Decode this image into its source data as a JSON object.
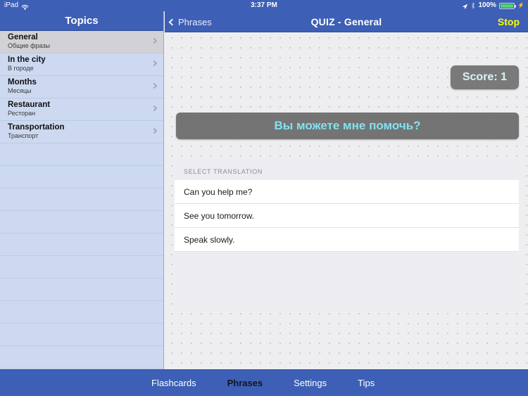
{
  "statusbar": {
    "device": "iPad",
    "wifi_icon": "wifi-icon",
    "time": "3:37 PM",
    "location_icon": "location-arrow-icon",
    "bluetooth_icon": "bluetooth-icon",
    "battery_percent": "100%",
    "battery_icon": "battery-full-icon"
  },
  "sidebar": {
    "title": "Topics",
    "items": [
      {
        "title": "General",
        "subtitle": "Общие фразы",
        "selected": true,
        "chevron": "chevron-right-icon"
      },
      {
        "title": "In the city",
        "subtitle": "В городе",
        "selected": false,
        "chevron": "chevron-right-icon"
      },
      {
        "title": "Months",
        "subtitle": "Месяцы",
        "selected": false,
        "chevron": "chevron-right-icon"
      },
      {
        "title": "Restaurant",
        "subtitle": "Ресторан",
        "selected": false,
        "chevron": "chevron-right-icon"
      },
      {
        "title": "Transportation",
        "subtitle": "Транспорт",
        "selected": false,
        "chevron": "chevron-right-icon"
      }
    ]
  },
  "nav": {
    "back_label": "Phrases",
    "back_icon": "chevron-left-icon",
    "title": "QUIZ - General",
    "stop_label": "Stop"
  },
  "quiz": {
    "score_label": "Score: 1",
    "question": "Вы можете мне помочь?",
    "section_header": "SELECT TRANSLATION",
    "options": [
      "Can you help me?",
      "See you tomorrow.",
      "Speak slowly."
    ]
  },
  "tabbar": {
    "tabs": [
      {
        "label": "Flashcards",
        "active": false
      },
      {
        "label": "Phrases",
        "active": true
      },
      {
        "label": "Settings",
        "active": false
      },
      {
        "label": "Tips",
        "active": false
      }
    ]
  },
  "colors": {
    "nav_blue": "#3d5fb5",
    "sidebar_blue": "#ccd9f0",
    "stop_yellow": "#ffff00",
    "question_cyan": "#7fe3f0",
    "battery_green": "#4cd964",
    "selected_row": "#d2d2d6"
  }
}
